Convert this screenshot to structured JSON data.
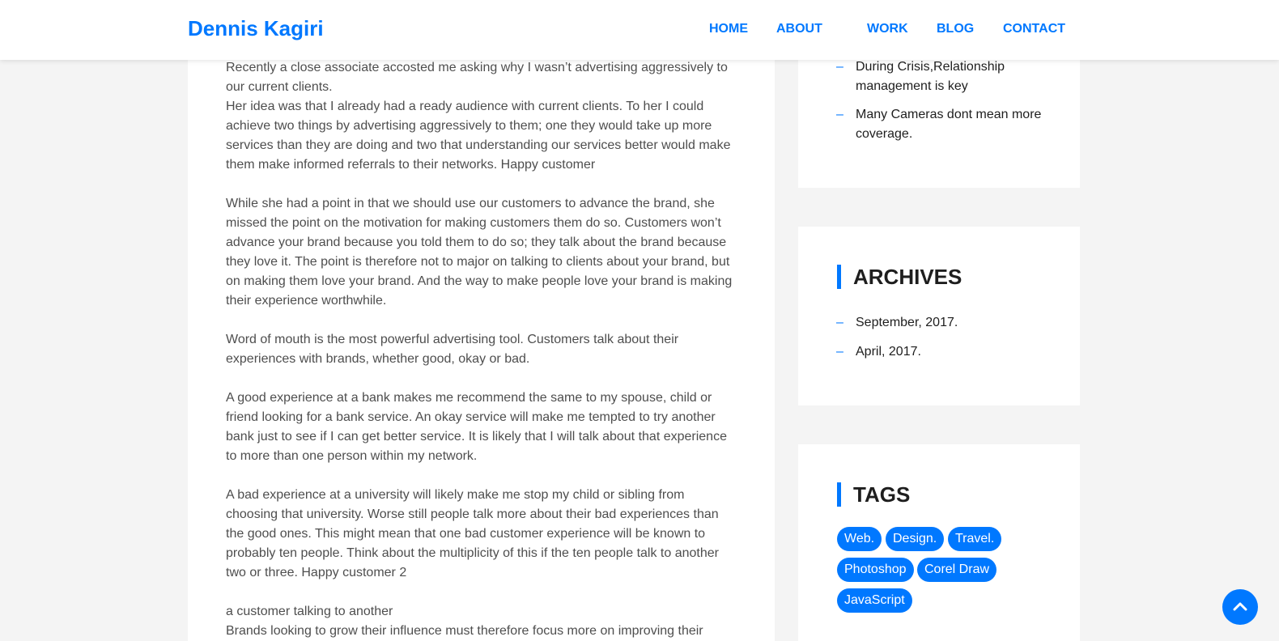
{
  "header": {
    "brand": "Dennis Kagiri",
    "nav": [
      "HOME",
      "ABOUT",
      "WORK",
      "BLOG",
      "CONTACT"
    ]
  },
  "post": {
    "paragraphs": [
      "Recently a close associate accosted me asking why I wasn’t advertising aggressively to our current clients.",
      "Her idea was that I already had a ready audience with current clients. To her I could achieve two things by advertising aggressively to them; one they would take up more services than they are doing and two that understanding our services better would make them make informed referrals to their networks. Happy customer",
      "While she had a point in that we should use our customers to advance the brand, she missed the point on the motivation for making customers them do so. Customers won’t advance your brand because you told them to do so; they talk about the brand because they love it. The point is therefore not to major on talking to clients about your brand, but on making them love your brand. And the way to make people love your brand is making their experience worthwhile.",
      "Word of mouth is the most powerful advertising tool. Customers talk about their experiences with brands, whether good, okay or bad.",
      "A good experience at a bank makes me recommend the same to my spouse, child or friend looking for a bank service. An okay service will make me tempted to try another bank just to see if I can get better service. It is likely that I will talk about that experience to more than one person within my network.",
      "A bad experience at a university will likely make me stop my child or sibling from choosing that university. Worse still people talk more about their bad experiences than the good ones. This might mean that one bad customer experience will be known to probably ten people. Think about the multiplicity of this if the ten people talk to another two or three. Happy customer 2",
      "a customer talking to another",
      "Brands looking to grow their influence must therefore focus more on improving their"
    ]
  },
  "sidebar": {
    "recent_posts": [
      "During Crisis,Relationship management is key",
      "Many Cameras dont mean more coverage."
    ],
    "archives": {
      "title": "ARCHIVES",
      "items": [
        "September, 2017.",
        "April, 2017."
      ]
    },
    "tags": {
      "title": "TAGS",
      "items": [
        "Web.",
        "Design.",
        "Travel.",
        "Photoshop",
        "Corel Draw",
        "JavaScript"
      ]
    },
    "dash": "–"
  },
  "colors": {
    "accent": "#0078ff",
    "page_bg": "#f4f4f4",
    "text": "#4e4e4e",
    "heading": "#1e1e1e"
  },
  "icons": {
    "back_to_top": "chevron-up-icon"
  }
}
